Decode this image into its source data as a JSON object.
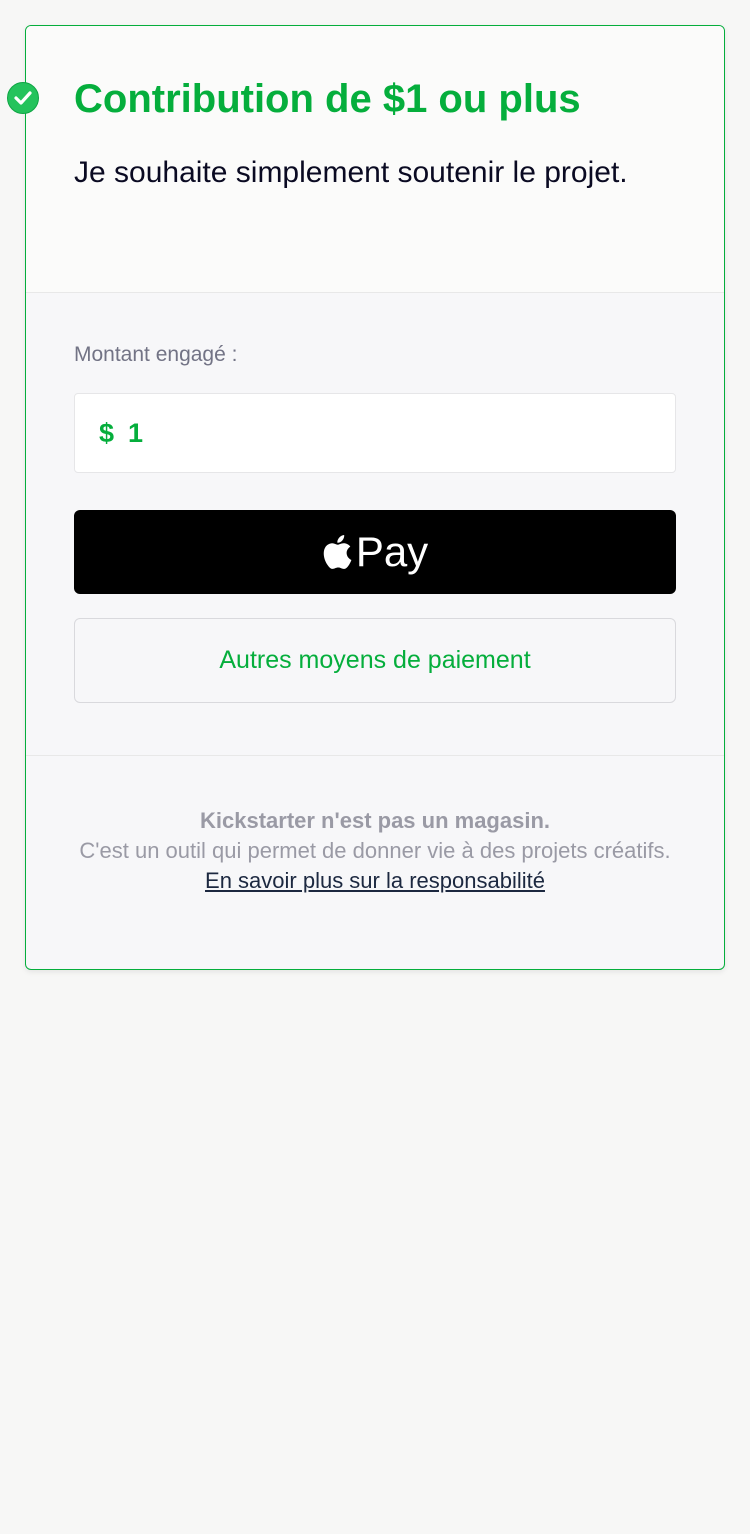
{
  "reward": {
    "title": "Contribution de $1 ou plus",
    "description": "Je souhaite simplement soutenir le projet.",
    "selected": true
  },
  "pledge": {
    "label": "Montant engagé :",
    "currency": "$",
    "amount": "1"
  },
  "buttons": {
    "apple_pay_label": "Pay",
    "other_payment_label": "Autres moyens de paiement"
  },
  "footer": {
    "headline": "Kickstarter n'est pas un magasin.",
    "body": "C'est un outil qui permet de donner vie à des projets créatifs.",
    "link": "En savoir plus sur la responsabilité"
  },
  "colors": {
    "accent": "#05ae3c",
    "check": "#24c35c"
  },
  "icons": {
    "selected": "check-circle-icon",
    "apple": "apple-logo-icon"
  }
}
